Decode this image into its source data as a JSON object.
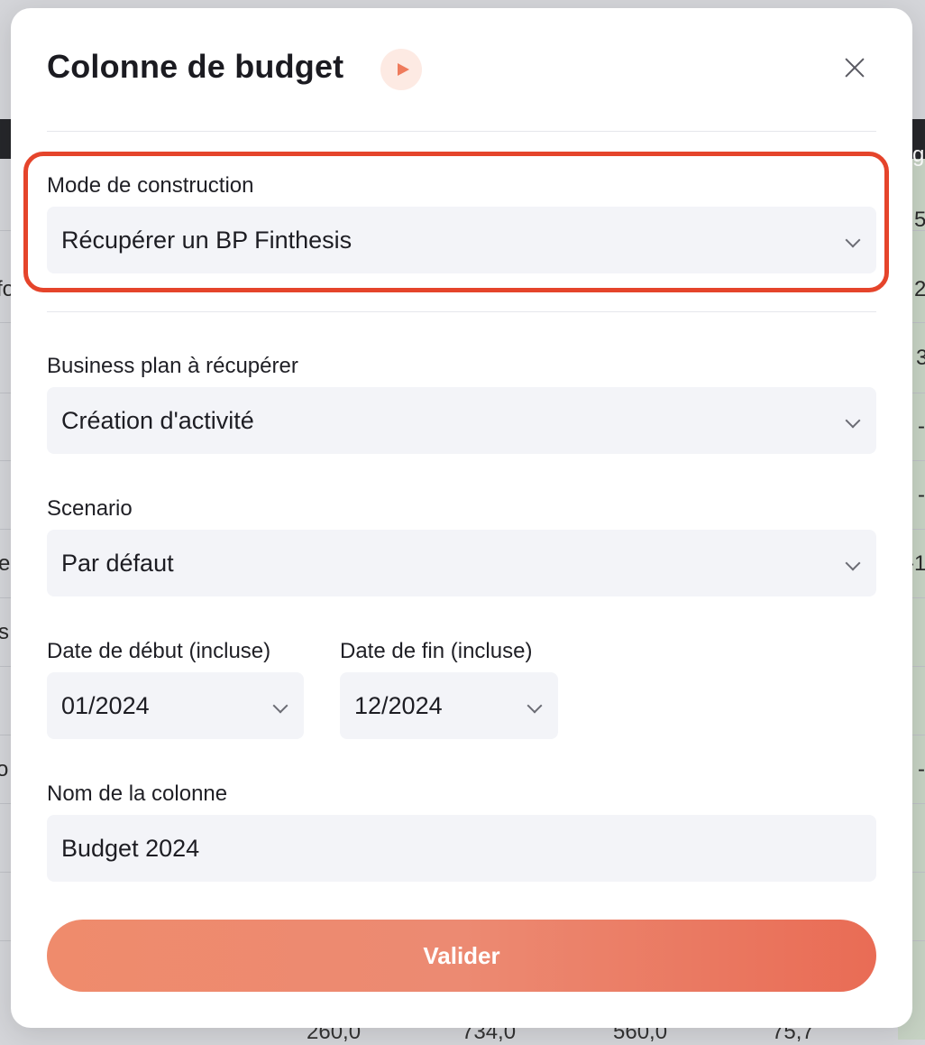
{
  "modal": {
    "title": "Colonne de budget",
    "close_icon": "close-icon",
    "play_icon": "play-icon"
  },
  "form": {
    "construction_mode": {
      "label": "Mode de construction",
      "value": "Récupérer un BP Finthesis"
    },
    "business_plan": {
      "label": "Business plan à récupérer",
      "value": "Création d'activité"
    },
    "scenario": {
      "label": "Scenario",
      "value": "Par défaut"
    },
    "start_date": {
      "label": "Date de début (incluse)",
      "value": "01/2024"
    },
    "end_date": {
      "label": "Date de fin (incluse)",
      "value": "12/2024"
    },
    "column_name": {
      "label": "Nom de la colonne",
      "value": "Budget 2024"
    },
    "submit_label": "Valider"
  },
  "background": {
    "right_fragments": [
      "g",
      "5",
      "2",
      "3",
      "-",
      "-",
      "-1",
      "-"
    ],
    "left_fragments": [
      "fo",
      "e",
      "s",
      "o"
    ],
    "bottom_numbers": [
      "260,0",
      "734,0",
      "560,0",
      "75,7"
    ]
  },
  "colors": {
    "accent": "#e5442b",
    "button_start": "#ef8b6c",
    "button_end": "#e96c55",
    "field_bg": "#f3f4f8"
  }
}
